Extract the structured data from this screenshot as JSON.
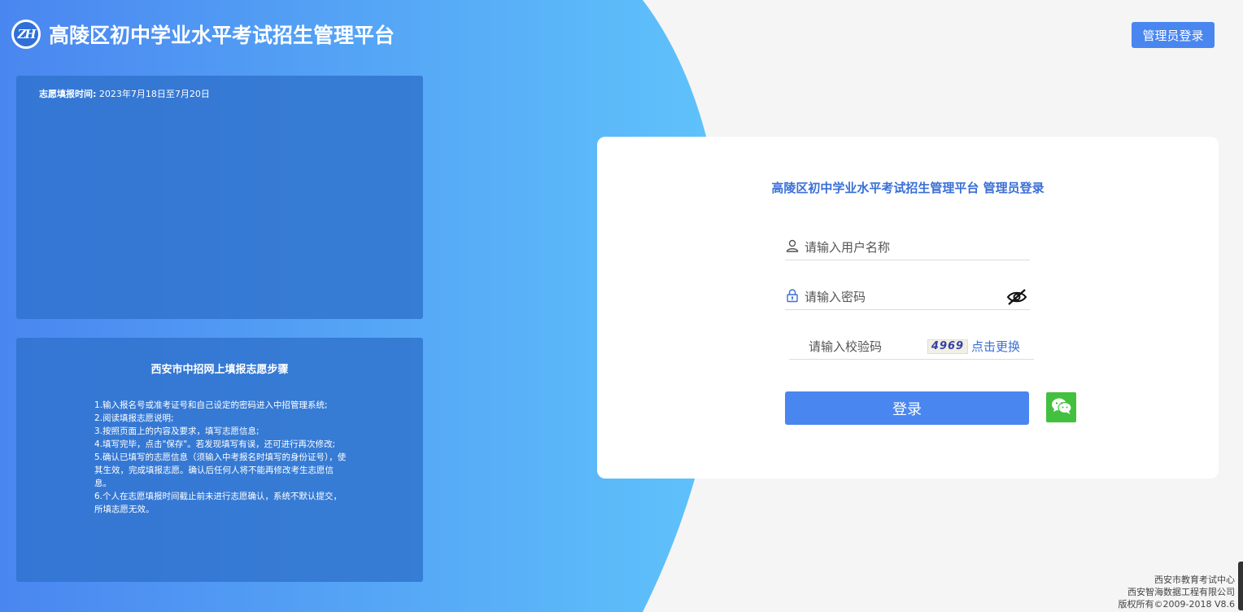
{
  "header": {
    "logo_text": "ZH",
    "title": "高陵区初中学业水平考试招生管理平台",
    "admin_login_label": "管理员登录"
  },
  "info_panel": {
    "time_label": "志愿填报时间:",
    "time_value": "2023年7月18日至7月20日"
  },
  "steps_panel": {
    "heading": "西安市中招网上填报志愿步骤",
    "steps": [
      "1.输入报名号或准考证号和自己设定的密码进入中招管理系统;",
      "2.阅读填报志愿说明;",
      "3.按照页面上的内容及要求，填写志愿信息;",
      "4.填写完毕，点击\"保存\"。若发现填写有误，还可进行再次修改;",
      "5.确认已填写的志愿信息（须输入中考报名时填写的身份证号），使其生效，完成填报志愿。确认后任何人将不能再修改考生志愿信息。",
      " 6.个人在志愿填报时间截止前未进行志愿确认，系统不默认提交，所填志愿无效。"
    ]
  },
  "login_card": {
    "title": "高陵区初中学业水平考试招生管理平台 管理员登录",
    "username_placeholder": "请输入用户名称",
    "password_placeholder": "请输入密码",
    "captcha_placeholder": "请输入校验码",
    "captcha_value": "4969",
    "captcha_refresh_label": "点击更换",
    "login_button_label": "登录"
  },
  "footer": {
    "line1": "西安市教育考试中心",
    "line2": "西安智海数据工程有限公司",
    "line3": "版权所有©2009-2018 V8.6"
  },
  "colors": {
    "accent": "#4a86f0",
    "gradient_start": "#4a86f0",
    "gradient_end": "#5fc3fb",
    "wechat": "#43c03f"
  }
}
